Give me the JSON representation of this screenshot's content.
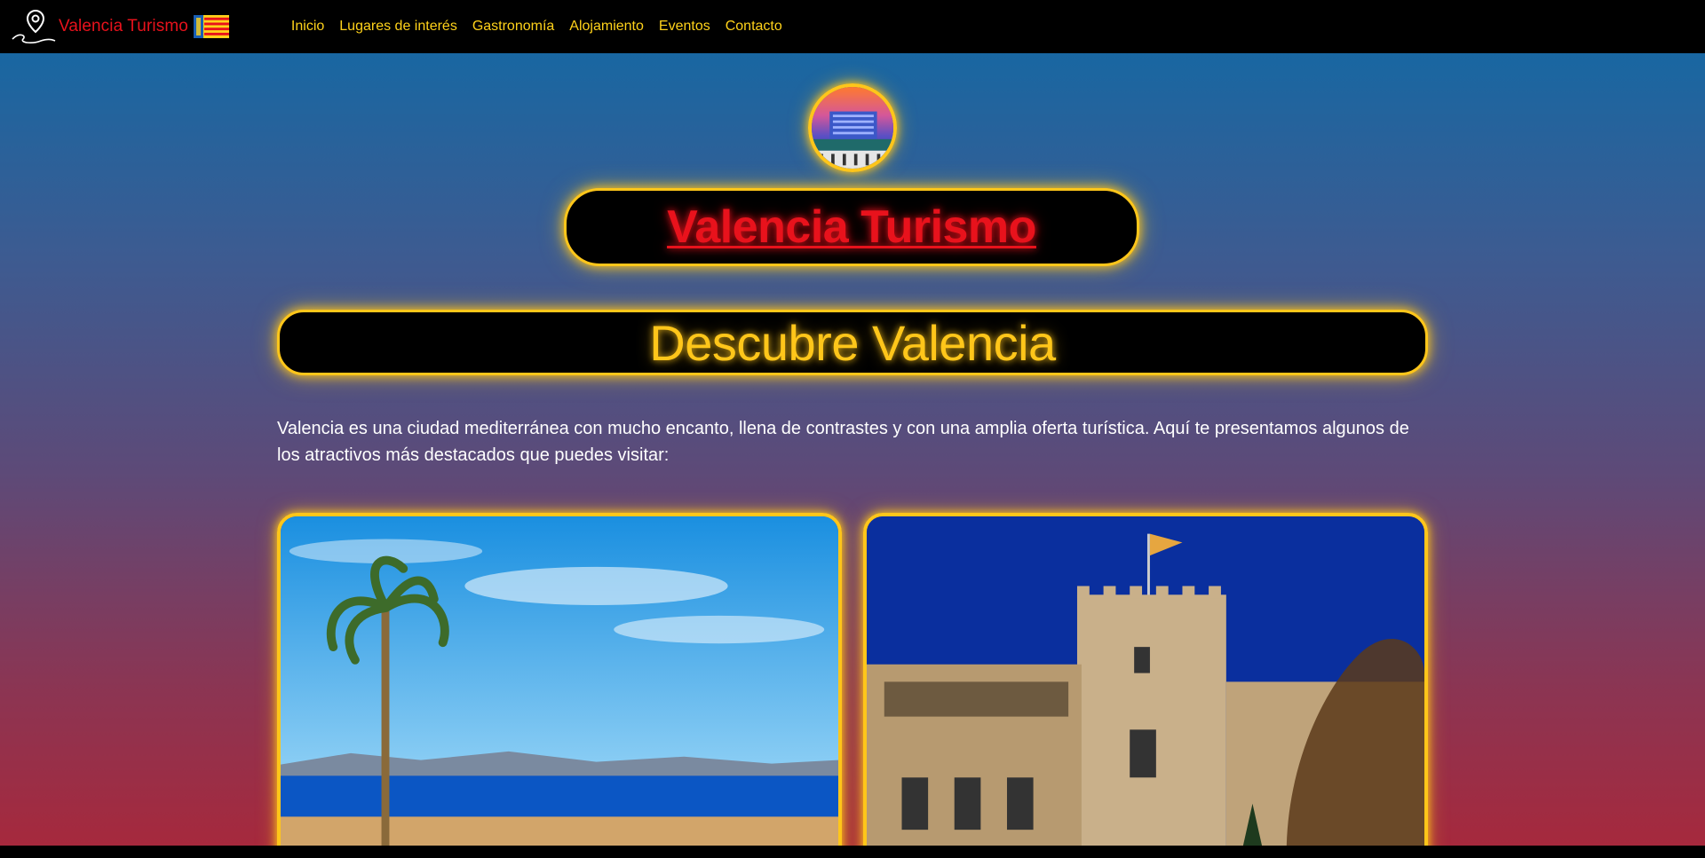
{
  "navbar": {
    "brand_name": "Valencia Turismo",
    "links": [
      "Inicio",
      "Lugares de interés",
      "Gastronomía",
      "Alojamiento",
      "Eventos",
      "Contacto"
    ]
  },
  "hero": {
    "title": "Valencia Turismo",
    "heading": "Descubre Valencia",
    "intro": "Valencia es una ciudad mediterránea con mucho encanto, llena de contrastes y con una amplia oferta turística. Aquí te presentamos algunos de los atractivos más destacados que puedes visitar:"
  },
  "colors": {
    "accent": "#ffc61a",
    "brand_red": "#e8121c",
    "navbar_bg": "#000000",
    "gradient_top": "#0f6aa6",
    "gradient_bottom": "#a8283b"
  },
  "icons": [
    "map-pin-icon",
    "valencia-flag-icon"
  ]
}
